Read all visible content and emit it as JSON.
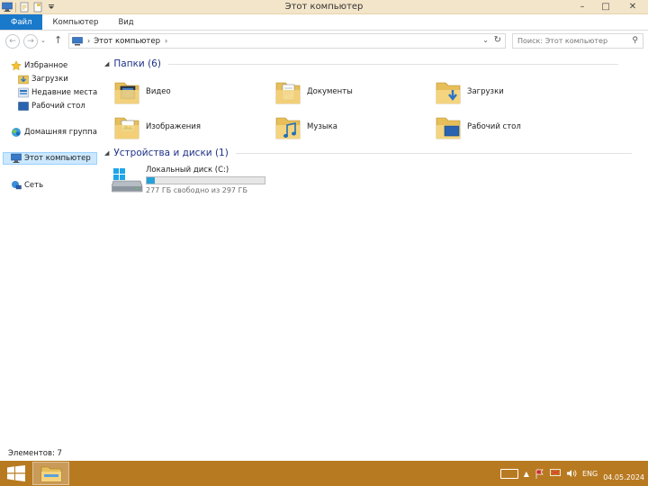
{
  "window": {
    "title": "Этот компьютер",
    "controls": {
      "minimize": "–",
      "maximize": "□",
      "close": "✕"
    }
  },
  "ribbon": {
    "tabs": [
      "Файл",
      "Компьютер",
      "Вид"
    ]
  },
  "address": {
    "back": "←",
    "forward": "→",
    "up": "↑",
    "separator": "›",
    "location": "Этот компьютер",
    "dropdown": "⌄",
    "refresh": "↻"
  },
  "search": {
    "placeholder": "Поиск: Этот компьютер",
    "icon": "search-icon",
    "glyph": "⚲"
  },
  "nav": {
    "favorites": {
      "label": "Избранное",
      "items": [
        "Загрузки",
        "Недавние места",
        "Рабочий стол"
      ]
    },
    "homegroup": "Домашняя группа",
    "this_pc": "Этот компьютер",
    "network": "Сеть"
  },
  "content": {
    "folders_header": "Папки (6)",
    "folders": [
      {
        "name": "Видео",
        "icon": "video-folder-icon"
      },
      {
        "name": "Документы",
        "icon": "documents-folder-icon"
      },
      {
        "name": "Загрузки",
        "icon": "downloads-folder-icon"
      },
      {
        "name": "Изображения",
        "icon": "pictures-folder-icon"
      },
      {
        "name": "Музыка",
        "icon": "music-folder-icon"
      },
      {
        "name": "Рабочий стол",
        "icon": "desktop-folder-icon"
      }
    ],
    "devices_header": "Устройства и диски (1)",
    "drive": {
      "name": "Локальный диск (C:)",
      "free_text": "277 ГБ свободно из 297 ГБ",
      "used_fraction": 0.067
    }
  },
  "status": {
    "items_count": "Элементов: 7"
  },
  "taskbar": {
    "language": "ENG",
    "date": "04.05.2024"
  },
  "colors": {
    "file_tab": "#1979ca",
    "title_bar": "#f3e5c9",
    "group_header": "#1e3287",
    "taskbar": "#b87a21",
    "drive_bar": "#26a0da"
  }
}
